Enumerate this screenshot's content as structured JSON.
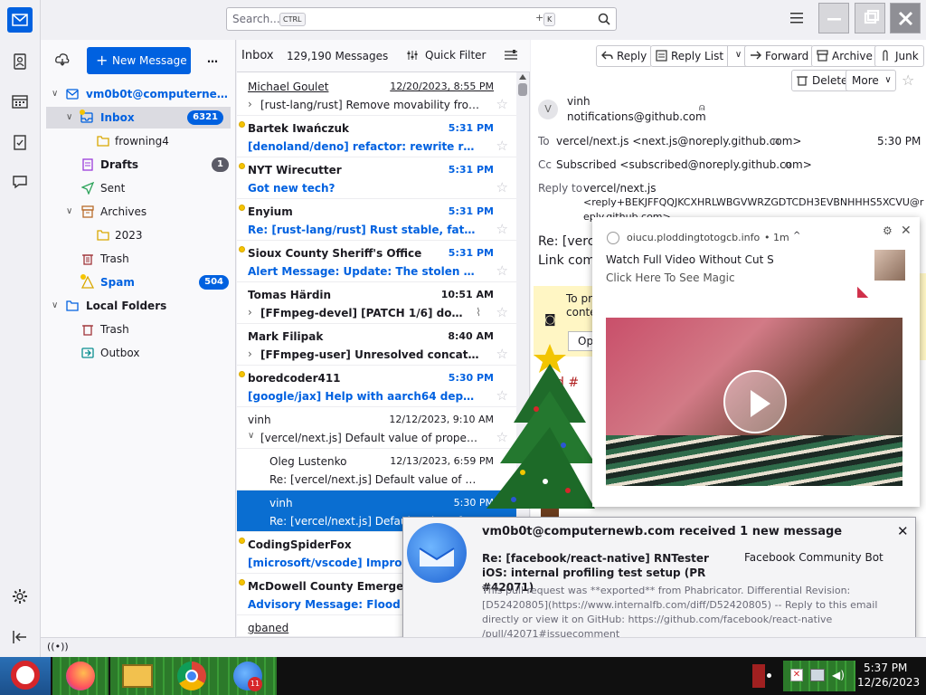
{
  "search": {
    "placeholder": "Search...",
    "key1": "CTRL",
    "plus": "+",
    "key2": "K"
  },
  "folder_pane": {
    "new_message": "New Message",
    "more": "…",
    "account": "vm0b0t@computernewb....",
    "folders": [
      {
        "label": "Inbox",
        "badge": "6321"
      },
      {
        "label": "frowning4"
      },
      {
        "label": "Drafts",
        "badge": "1"
      },
      {
        "label": "Sent"
      },
      {
        "label": "Archives"
      },
      {
        "label": "2023"
      },
      {
        "label": "Trash"
      },
      {
        "label": "Spam",
        "badge": "504"
      },
      {
        "label": "Local Folders"
      },
      {
        "label": "Trash"
      },
      {
        "label": "Outbox"
      }
    ]
  },
  "message_list": {
    "title": "Inbox",
    "count": "129,190 Messages",
    "quick_filter": "Quick Filter",
    "messages": [
      {
        "from": "Michael Goulet",
        "date": "12/20/2023, 8:55 PM",
        "subject": "[rust-lang/rust] Remove movability from..."
      },
      {
        "from": "Bartek Iwańczuk",
        "date": "5:31 PM",
        "subject": "[denoland/deno] refactor: rewrite rema..."
      },
      {
        "from": "NYT Wirecutter",
        "date": "5:31 PM",
        "subject": "Got new tech?"
      },
      {
        "from": "Enyium",
        "date": "5:31 PM",
        "subject": "Re: [rust-lang/rust] Rust stable, fatal ru..."
      },
      {
        "from": "Sioux County Sheriff's Office",
        "date": "5:31 PM",
        "subject": "Alert Message: Update: The stolen gree..."
      },
      {
        "from": "Tomas Härdin",
        "date": "10:51 AM",
        "subject": "[FFmpeg-devel] [PATCH 1/6] doc/..."
      },
      {
        "from": "Mark Filipak",
        "date": "8:40 AM",
        "subject": "[FFmpeg-user] Unresolved concatena..."
      },
      {
        "from": "boredcoder411",
        "date": "5:30 PM",
        "subject": "[google/jax] Help with aarch64 depend..."
      },
      {
        "from": "vinh",
        "date": "12/12/2023, 9:10 AM",
        "subject": "[vercel/next.js] Default value of property..."
      },
      {
        "from": "Oleg Lustenko",
        "date": "12/13/2023, 6:59 PM",
        "subject": "Re: [vercel/next.js] Default value of pro..."
      },
      {
        "from": "vinh",
        "date": "5:30 PM",
        "subject": "Re: [vercel/next.js] Default value of..."
      },
      {
        "from": "CodingSpiderFox",
        "date": "",
        "subject": "[microsoft/vscode] Improve..."
      },
      {
        "from": "McDowell County Emergency M...",
        "date": "",
        "subject": "Advisory Message: Flood Ad..."
      },
      {
        "from": "gbaned",
        "date": "",
        "subject": ""
      }
    ]
  },
  "toolbar": {
    "reply": "Reply",
    "reply_list": "Reply List",
    "forward": "Forward",
    "archive": "Archive",
    "junk": "Junk",
    "delete": "Delete",
    "more": "More"
  },
  "header": {
    "avatar": "V",
    "from_name": "vinh",
    "from_email": "notifications@github.com",
    "to_label": "To",
    "to": "vercel/next.js <next.js@noreply.github.com>",
    "time": "5:30 PM",
    "cc_label": "Cc",
    "cc": "Subscribed <subscribed@noreply.github.com>",
    "replyto_label": "Reply to",
    "replyto_line1": "vercel/next.js",
    "replyto_line2": "<reply+BEKJFFQQJKCXHRLWBGVWRZGDTCDH3EVBNHHHS5XCVU@r",
    "replyto_line3": "eply.github.com>"
  },
  "body_partial": {
    "subject_fragment": "Re: [verc",
    "link_fragment": "Link com",
    "banner_fragment1": "To pr",
    "banner_fragment2": "conte",
    "button_fragment": "Op",
    "text_fragment": "d #"
  },
  "ad_popup": {
    "domain": "oiucu.ploddingtotogcb.info",
    "age": "• 1m",
    "title": "Watch Full Video Without Cut S",
    "subtitle": "Click Here To See Magic"
  },
  "notification": {
    "title": "vm0b0t@computernewb.com received 1 new message",
    "subject": "Re: [facebook/react-native] RNTester iOS: internal profiling test setup (PR #42071)",
    "sender": "Facebook Community Bot",
    "preview": "This pull request was **exported** from Phabricator. Differential Revision: [D52420805](https://www.internalfb.com/diff/D52420805) -- Reply to this email directly or view it on GitHub: https://github.com/facebook/react-native /pull/42071#issuecomment",
    "badge_count": "11"
  },
  "taskbar": {
    "time": "5:37 PM",
    "date": "12/26/2023"
  },
  "colors": {
    "accent": "#0061e0",
    "selection": "#0a6ed1",
    "unread_dot": "#f5c400"
  }
}
